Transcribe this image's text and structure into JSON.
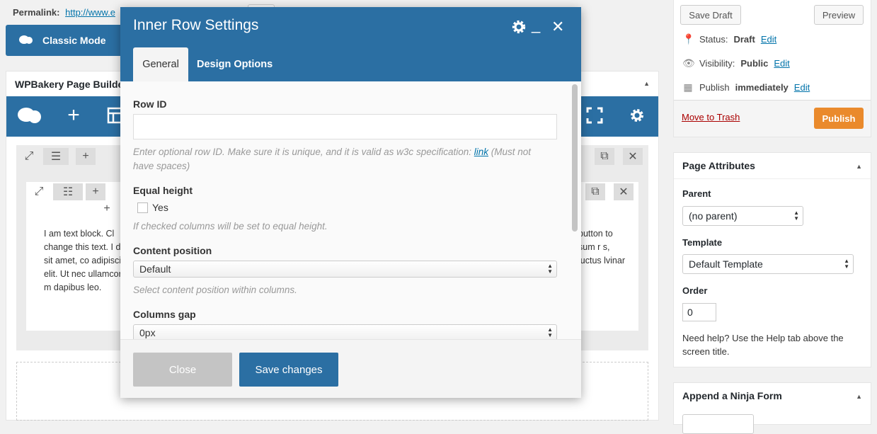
{
  "permalink": {
    "label": "Permalink:",
    "url": "http://www.e"
  },
  "classic_mode": {
    "label": "Classic Mode"
  },
  "builder": {
    "title": "WPBakery Page Builde",
    "text_left": "I am text block. Cl change this text. I dolor sit amet, co adipiscing elit. Ut nec ullamcorper m dapibus leo.",
    "text_right": "button to sum r s, luctus lvinar"
  },
  "publish_box": {
    "save_draft": "Save Draft",
    "preview": "Preview",
    "status_label": "Status:",
    "status_value": "Draft",
    "visibility_label": "Visibility:",
    "visibility_value": "Public",
    "publish_label": "Publish",
    "publish_value": "immediately",
    "edit": "Edit",
    "move_to_trash": "Move to Trash",
    "publish_button": "Publish"
  },
  "page_attributes": {
    "title": "Page Attributes",
    "parent_label": "Parent",
    "parent_value": "(no parent)",
    "template_label": "Template",
    "template_value": "Default Template",
    "order_label": "Order",
    "order_value": "0",
    "help_text": "Need help? Use the Help tab above the screen title."
  },
  "ninja_box": {
    "title": "Append a Ninja Form"
  },
  "modal": {
    "title": "Inner Row Settings",
    "tabs": [
      {
        "label": "General"
      },
      {
        "label": "Design Options"
      }
    ],
    "row_id": {
      "label": "Row ID",
      "value": "",
      "desc_before": "Enter optional row ID. Make sure it is unique, and it is valid as w3c specification:",
      "link": "link",
      "desc_after": "(Must not have spaces)"
    },
    "equal_height": {
      "label": "Equal height",
      "checkbox_label": "Yes",
      "checked": false,
      "desc": "If checked columns will be set to equal height."
    },
    "content_position": {
      "label": "Content position",
      "value": "Default",
      "desc": "Select content position within columns."
    },
    "columns_gap": {
      "label": "Columns gap",
      "value": "0px"
    },
    "close_button": "Close",
    "save_button": "Save changes"
  },
  "colors": {
    "accent": "#2b6fa3",
    "publish": "#ea8a2c",
    "trash": "#aa0000"
  }
}
